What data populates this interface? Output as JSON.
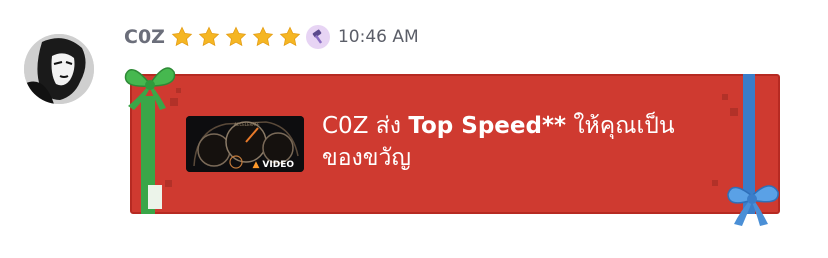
{
  "header": {
    "username": "C0Z",
    "star_count": 5,
    "badge_icon": "hammer-badge-icon",
    "timestamp": "10:46 AM"
  },
  "gift": {
    "sender": "C0Z",
    "verb": "ส่ง",
    "item_name": "Top Speed**",
    "suffix": "ให้คุณเป็น",
    "line2": "ของขวัญ",
    "thumbnail_tag": "VIDEO",
    "colors": {
      "box": "#cf3a30",
      "ribbon_blue": "#3a7dc9",
      "ribbon_green": "#3aa648"
    }
  }
}
